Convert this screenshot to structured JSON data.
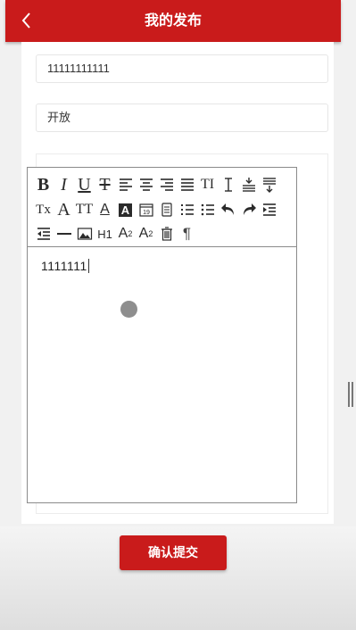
{
  "header": {
    "title": "我的发布",
    "back_icon": "chevron-left-icon"
  },
  "form": {
    "title_value": "11111111111",
    "status_value": "开放",
    "editor": {
      "content": "1111111",
      "toolbar": {
        "row1": [
          "bold",
          "italic",
          "underline",
          "strikethrough",
          "align-left",
          "align-center",
          "align-right",
          "align-justify",
          "font-size",
          "line-height",
          "row-spacing-top",
          "row-spacing-bottom"
        ],
        "row2": [
          "remove-format",
          "font-family",
          "paragraph-style",
          "font-color",
          "background-color",
          "insert-date",
          "insert-time",
          "ordered-list",
          "unordered-list",
          "undo",
          "redo",
          "indent"
        ],
        "row3": [
          "outdent",
          "horizontal-rule",
          "insert-image",
          "heading-1",
          "subscript",
          "superscript",
          "clear-content",
          "paragraph-mark"
        ],
        "labels": {
          "bold": "B",
          "italic": "I",
          "underline": "U",
          "strike": "T",
          "tt": "TI",
          "tx": "Tx",
          "font": "A",
          "ptt": "TT",
          "fontcolor": "A",
          "bgcolor": "A",
          "date": "19",
          "h1": "H1",
          "sub": "A",
          "sup": "A",
          "para": "¶",
          "subnum": "2",
          "supnum": "2"
        }
      }
    }
  },
  "submit_label": "确认提交",
  "colors": {
    "accent": "#c91b1b",
    "background": "#f1f1f1"
  }
}
